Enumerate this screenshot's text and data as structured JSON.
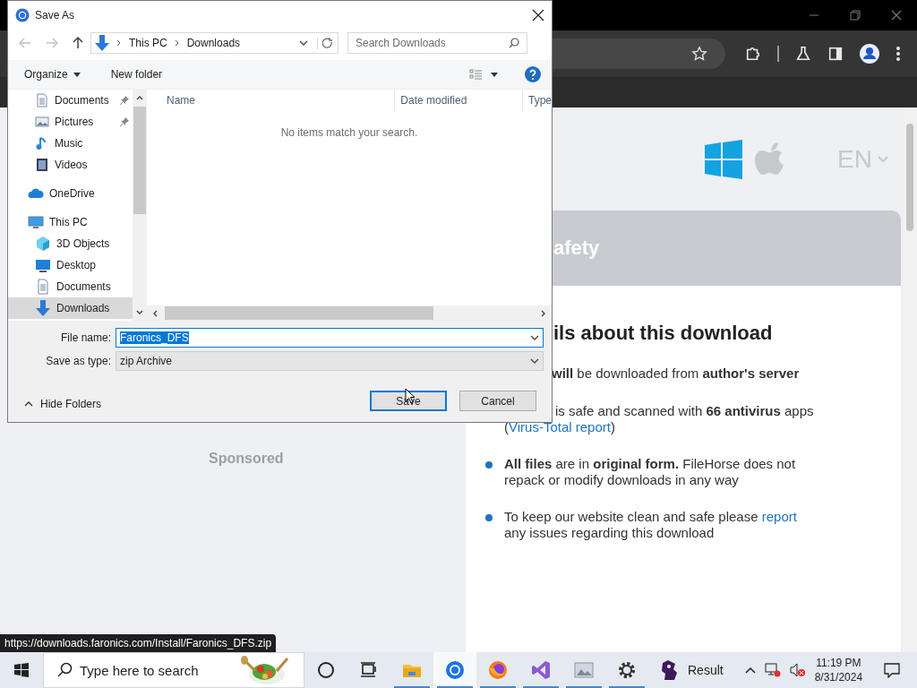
{
  "page": {
    "language": "EN",
    "section_title": "afety",
    "sponsored": "Sponsored",
    "details": {
      "heading": "ils about this download",
      "bullets": [
        {
          "lines": [
            [
              {
                "text": "**will** be downloaded from **author's server**",
                "link": false
              }
            ]
          ]
        },
        {
          "lines": [
            [
              {
                "text": "is safe and scanned with **66 antivirus** apps",
                "link": false
              }
            ],
            [
              {
                "text": "(",
                "link": false
              },
              {
                "text": "Virus-Total report",
                "link": true
              },
              {
                "text": ")",
                "link": false
              }
            ]
          ]
        },
        {
          "lines": [
            [
              {
                "text": "**All files** are in **original form.** FileHorse does not",
                "link": false
              }
            ],
            [
              {
                "text": "repack or modify downloads in any way",
                "link": false
              }
            ]
          ]
        },
        {
          "lines": [
            [
              {
                "text": "To keep our website clean and safe please ",
                "link": false
              },
              {
                "text": "report",
                "link": true
              }
            ],
            [
              {
                "text": "any issues regarding this download",
                "link": false
              }
            ]
          ]
        }
      ]
    }
  },
  "status_url": "https://downloads.faronics.com/Install/Faronics_DFS.zip",
  "dialog": {
    "title": "Save As",
    "breadcrumb": [
      "This PC",
      "Downloads"
    ],
    "search": {
      "placeholder": "Search Downloads"
    },
    "commands": [
      "Organize",
      "New folder"
    ],
    "quick_access": [
      {
        "label": "Documents",
        "kind": "documents",
        "pinned": true,
        "selected": false
      },
      {
        "label": "Pictures",
        "kind": "pictures",
        "pinned": true,
        "selected": false
      },
      {
        "label": "Music",
        "kind": "music",
        "pinned": false,
        "selected": false
      },
      {
        "label": "Videos",
        "kind": "videos",
        "pinned": false,
        "selected": false
      }
    ],
    "nav_tree": [
      {
        "label": "OneDrive",
        "kind": "cloud",
        "selected": false
      },
      {
        "label": "This PC",
        "kind": "pc",
        "selected": false,
        "children": [
          {
            "label": "3D Objects",
            "kind": "objects",
            "selected": false
          },
          {
            "label": "Desktop",
            "kind": "desktop",
            "selected": false
          },
          {
            "label": "Documents",
            "kind": "documents",
            "selected": false
          },
          {
            "label": "Downloads",
            "kind": "downloads",
            "selected": true
          }
        ]
      }
    ],
    "columns": [
      "Name",
      "Date modified",
      "Type"
    ],
    "empty_message": "No items match your search.",
    "file_name": {
      "label": "File name:",
      "value": "Faronics_DFS",
      "text_selected": true
    },
    "save_type": {
      "label": "Save as type:",
      "value": "zip Archive"
    },
    "hide_folders": "Hide Folders",
    "buttons": [
      {
        "label": "Save",
        "default": true
      },
      {
        "label": "Cancel",
        "default": false
      }
    ]
  },
  "taskbar": {
    "search_placeholder": "Type here to search",
    "apps": [
      {
        "kind": "cortana",
        "running": false,
        "selected": false
      },
      {
        "kind": "taskview",
        "running": false,
        "selected": false
      },
      {
        "kind": "explorer",
        "running": true,
        "selected": false
      },
      {
        "kind": "chrome",
        "running": true,
        "selected": true
      },
      {
        "kind": "firefox",
        "running": true,
        "selected": false
      },
      {
        "kind": "studio",
        "running": true,
        "selected": false
      },
      {
        "kind": "photos",
        "running": true,
        "selected": false
      },
      {
        "kind": "settings",
        "running": true,
        "selected": false
      }
    ],
    "widget": "Result",
    "time": "11:19 PM",
    "date": "8/31/2024"
  }
}
